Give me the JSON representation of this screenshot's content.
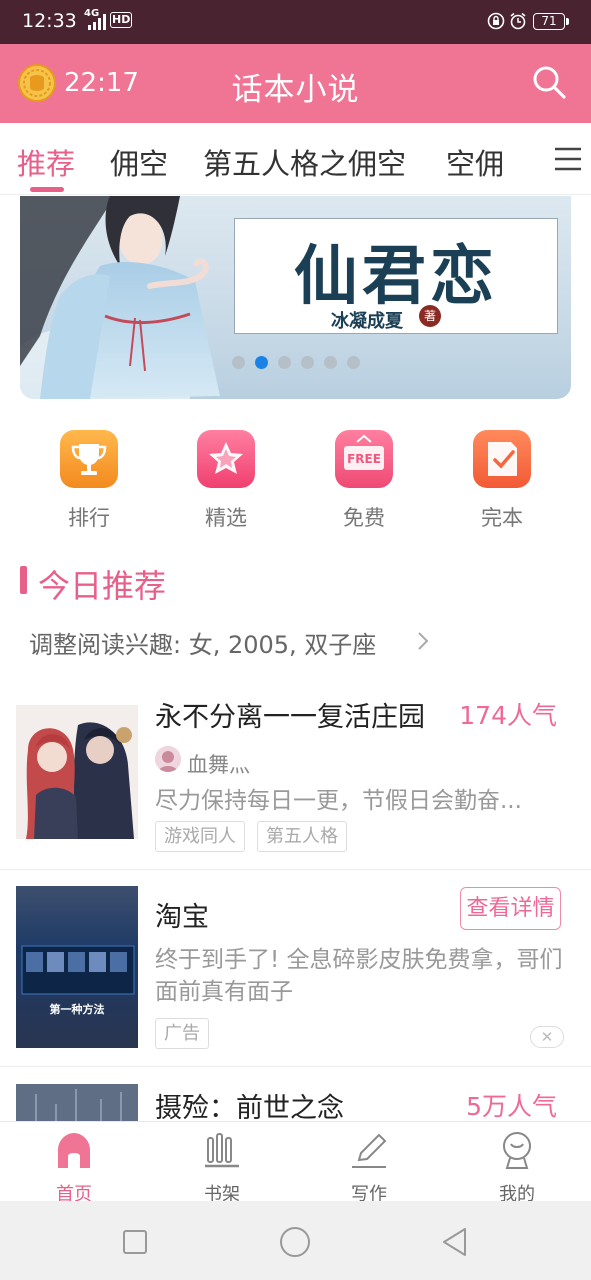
{
  "status_bar": {
    "time": "12:33",
    "network": "4G",
    "hd": "HD",
    "battery": "71"
  },
  "header": {
    "timer": "22:17",
    "title": "话本小说"
  },
  "tabs": [
    "推荐",
    "佣空",
    "第五人格之佣空",
    "空佣"
  ],
  "tab_fragment": "?",
  "banner": {
    "title": "仙君恋",
    "author": "冰凝成夏",
    "author_seal": "著",
    "slide_count": 6,
    "active_slide": 2
  },
  "categories": [
    {
      "label": "排行",
      "icon": "trophy-icon",
      "color": "#f7a031"
    },
    {
      "label": "精选",
      "icon": "star-icon",
      "color": "#f4577e"
    },
    {
      "label": "免费",
      "icon": "free-icon",
      "color": "#f2587f"
    },
    {
      "label": "完本",
      "icon": "check-note-icon",
      "color": "#f8663f"
    }
  ],
  "section": {
    "title": "今日推荐",
    "interest": "调整阅读兴趣: 女, 2005, 双子座"
  },
  "items": [
    {
      "title": "永不分离一一复活庄园",
      "popularity": "174人气",
      "author": "血舞灬",
      "description": "尽力保持每日一更，节假日会勤奋...",
      "tags": [
        "游戏同人",
        "第五人格"
      ]
    },
    {
      "title": "淘宝",
      "button": "查看详情",
      "description": "终于到手了! 全息碎影皮肤免费拿，哥们面前真有面子",
      "ad_tag": "广告",
      "cover_caption": "第一种方法"
    },
    {
      "title": "摄殓：前世之念",
      "popularity": "5万人气"
    }
  ],
  "bottom_nav": [
    "首页",
    "书架",
    "写作",
    "我的"
  ],
  "colors": {
    "accent": "#f07494",
    "accent_text": "#e8608a",
    "statusbar": "#4a2330"
  }
}
